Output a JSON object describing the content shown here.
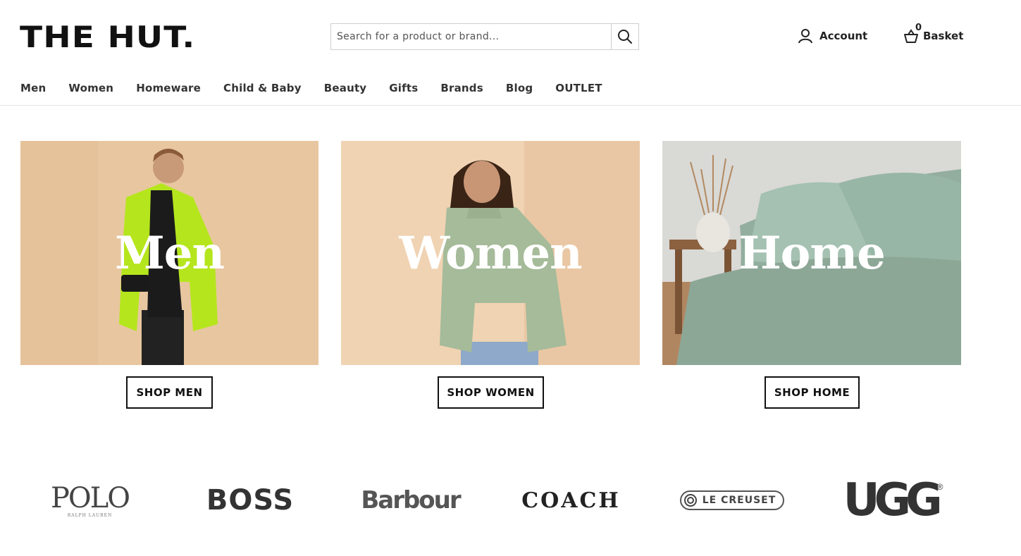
{
  "header": {
    "logo": "THE HUT.",
    "search_placeholder": "Search for a product or brand...",
    "account_label": "Account",
    "basket_label": "Basket",
    "basket_count": "0"
  },
  "nav": [
    "Men",
    "Women",
    "Homeware",
    "Child & Baby",
    "Beauty",
    "Gifts",
    "Brands",
    "Blog",
    "OUTLET"
  ],
  "tiles": [
    {
      "label": "Men",
      "button": "SHOP MEN"
    },
    {
      "label": "Women",
      "button": "SHOP WOMEN"
    },
    {
      "label": "Home",
      "button": "SHOP HOME"
    }
  ],
  "brands": [
    "POLO",
    "RALPH LAUREN",
    "BOSS",
    "Barbour",
    "COACH",
    "LE CREUSET",
    "UGG"
  ],
  "colors": {
    "text": "#1a1a1a",
    "border": "#cfcfcf",
    "white": "#ffffff"
  }
}
